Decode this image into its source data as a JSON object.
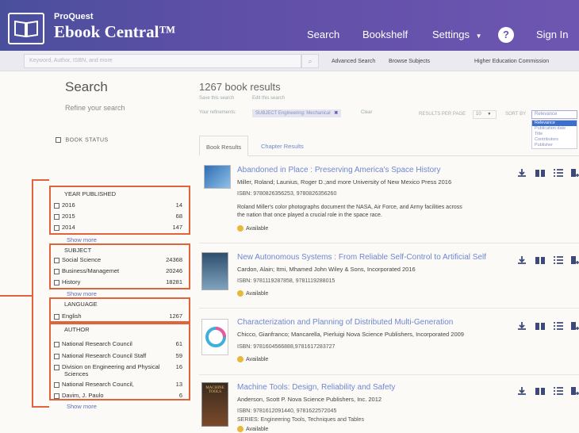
{
  "header": {
    "brand_small": "ProQuest",
    "brand_big": "Ebook Central™",
    "nav": {
      "search": "Search",
      "bookshelf": "Bookshelf",
      "settings": "Settings",
      "help": "?",
      "signin": "Sign In"
    }
  },
  "strip": {
    "search_placeholder": "Keyword, Author, ISBN, and more",
    "advanced": "Advanced Search",
    "browse": "Browse Subjects",
    "institution": "Higher Education Commission"
  },
  "sidebar": {
    "title": "Search",
    "refine": "Refine your search",
    "book_status": "BOOK STATUS",
    "show_more": "Show more",
    "year": {
      "heading": "YEAR PUBLISHED",
      "rows": [
        {
          "label": "2016",
          "count": "14"
        },
        {
          "label": "2015",
          "count": "68"
        },
        {
          "label": "2014",
          "count": "147"
        }
      ]
    },
    "subject": {
      "heading": "SUBJECT",
      "rows": [
        {
          "label": "Social Science",
          "count": "24368"
        },
        {
          "label": "Business/Managemet",
          "count": "20246"
        },
        {
          "label": "History",
          "count": "18281"
        }
      ]
    },
    "language": {
      "heading": "LANGUAGE",
      "rows": [
        {
          "label": "English",
          "count": "1267"
        }
      ]
    },
    "author": {
      "heading": "AUTHOR",
      "rows": [
        {
          "label": "National Research Council",
          "count": "61"
        },
        {
          "label": "National Research Council Staff",
          "count": "59"
        },
        {
          "label": "Division on Engineering and Physical",
          "label2": "Sciences",
          "count": "16"
        },
        {
          "label": "National Research Council,",
          "count": "13"
        },
        {
          "label": "Davim, J. Paulo",
          "count": "6"
        }
      ]
    }
  },
  "results": {
    "count_title": "1267 book results",
    "save_search": "Save this search",
    "edit_search": "Edit this search",
    "refinements_label": "Your refinements:",
    "refinement_tag": "SUBJECT Engineering: Mechanical",
    "clear": "Clear",
    "per_page_label": "RESULTS PER PAGE",
    "per_page_value": "10",
    "sort_label": "SORT BY",
    "sort_value": "Relevance",
    "sort_options": [
      "Relevance",
      "Publication date",
      "Title",
      "Contributors",
      "Publisher"
    ],
    "tabs": {
      "books": "Book Results",
      "chapters": "Chapter Results"
    },
    "available": "Available",
    "books": [
      {
        "title": "Abandoned in Place : Preserving America's Space History",
        "meta": "Miller, Roland; Launius, Roger D.;and more  University of New Mexico Press  2016",
        "isbn": "ISBN: 9780826356253, 9780826356260",
        "desc1": "Roland Miller's color photographs document the NASA, Air Force, and Army facilities across",
        "desc2": "the nation that once played a crucial role in the space race."
      },
      {
        "title": "New Autonomous Systems : From Reliable Self-Control to Artificial Self",
        "meta": "Cardon, Alain; Itmi, Mhamed  John Wiley & Sons, Incorporated  2016",
        "isbn": "ISBN: 9781119287858, 9781119288015"
      },
      {
        "title": "Characterization and Planning of Distributed Multi-Generation",
        "meta": "Chicco, Gianfranco; Mancarella, Pierluigi  Nova Science Publishers, Incorporated  2009",
        "isbn": "ISBN: 9781604566888,9781617283727"
      },
      {
        "title": "Machine Tools: Design, Reliability and Safety",
        "meta": "Anderson, Scott P.  Nova Science Publishers, Inc.  2012",
        "isbn": "ISBN: 9781612091440, 9781622572045",
        "series": "SERIES: Engineering Tools, Techniques and Tables",
        "cover_text": "MACHINE TOOLS"
      }
    ]
  }
}
